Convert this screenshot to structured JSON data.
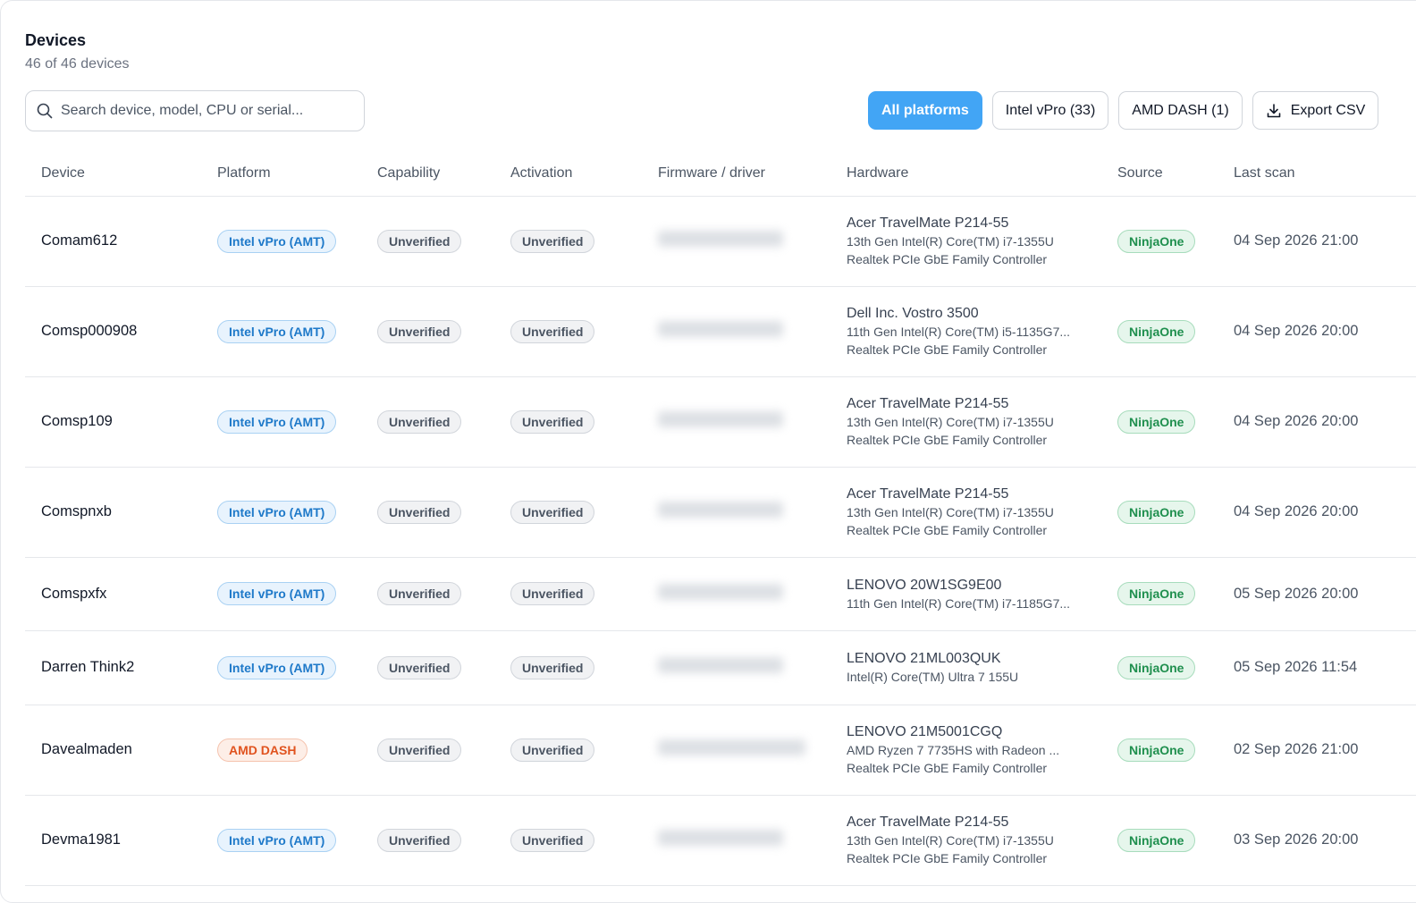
{
  "header": {
    "title": "Devices",
    "subtitle": "46 of 46 devices"
  },
  "search": {
    "placeholder": "Search device, model, CPU or serial..."
  },
  "filters": {
    "all": "All platforms",
    "intel": "Intel vPro (33)",
    "amd": "AMD DASH (1)",
    "export": "Export CSV"
  },
  "columns": {
    "device": "Device",
    "platform": "Platform",
    "capability": "Capability",
    "activation": "Activation",
    "firmware": "Firmware / driver",
    "hardware": "Hardware",
    "source": "Source",
    "last_scan": "Last scan"
  },
  "colors": {
    "accent": "#42a5f5",
    "intel_pill": "#1e79c9",
    "amd_pill": "#e0531f",
    "source_pill": "#1f8f4e"
  },
  "rows": [
    {
      "device": "Comam612",
      "platform": "Intel vPro (AMT)",
      "platform_type": "intel",
      "capability": "Unverified",
      "activation": "Unverified",
      "hardware": [
        "Acer TravelMate P214-55",
        "13th Gen Intel(R) Core(TM) i7-1355U",
        "Realtek PCIe GbE Family Controller"
      ],
      "source": "NinjaOne",
      "last_scan": "04 Sep 2026 21:00"
    },
    {
      "device": "Comsp000908",
      "platform": "Intel vPro (AMT)",
      "platform_type": "intel",
      "capability": "Unverified",
      "activation": "Unverified",
      "hardware": [
        "Dell Inc. Vostro 3500",
        "11th Gen Intel(R) Core(TM) i5-1135G7...",
        "Realtek PCIe GbE Family Controller"
      ],
      "source": "NinjaOne",
      "last_scan": "04 Sep 2026 20:00"
    },
    {
      "device": "Comsp109",
      "platform": "Intel vPro (AMT)",
      "platform_type": "intel",
      "capability": "Unverified",
      "activation": "Unverified",
      "hardware": [
        "Acer TravelMate P214-55",
        "13th Gen Intel(R) Core(TM) i7-1355U",
        "Realtek PCIe GbE Family Controller"
      ],
      "source": "NinjaOne",
      "last_scan": "04 Sep 2026 20:00"
    },
    {
      "device": "Comspnxb",
      "platform": "Intel vPro (AMT)",
      "platform_type": "intel",
      "capability": "Unverified",
      "activation": "Unverified",
      "hardware": [
        "Acer TravelMate P214-55",
        "13th Gen Intel(R) Core(TM) i7-1355U",
        "Realtek PCIe GbE Family Controller"
      ],
      "source": "NinjaOne",
      "last_scan": "04 Sep 2026 20:00"
    },
    {
      "device": "Comspxfx",
      "platform": "Intel vPro (AMT)",
      "platform_type": "intel",
      "capability": "Unverified",
      "activation": "Unverified",
      "hardware": [
        "LENOVO 20W1SG9E00",
        "11th Gen Intel(R) Core(TM) i7-1185G7..."
      ],
      "source": "NinjaOne",
      "last_scan": "05 Sep 2026 20:00"
    },
    {
      "device": "Darren Think2",
      "platform": "Intel vPro (AMT)",
      "platform_type": "intel",
      "capability": "Unverified",
      "activation": "Unverified",
      "hardware": [
        "LENOVO 21ML003QUK",
        "Intel(R) Core(TM) Ultra 7 155U"
      ],
      "source": "NinjaOne",
      "last_scan": "05 Sep 2026 11:54"
    },
    {
      "device": "Davealmaden",
      "platform": "AMD DASH",
      "platform_type": "amd",
      "capability": "Unverified",
      "activation": "Unverified",
      "hardware": [
        "LENOVO 21M5001CGQ",
        "AMD Ryzen 7 7735HS with Radeon ...",
        "Realtek PCIe GbE Family Controller"
      ],
      "source": "NinjaOne",
      "last_scan": "02 Sep 2026 21:00"
    },
    {
      "device": "Devma1981",
      "platform": "Intel vPro (AMT)",
      "platform_type": "intel",
      "capability": "Unverified",
      "activation": "Unverified",
      "hardware": [
        "Acer TravelMate P214-55",
        "13th Gen Intel(R) Core(TM) i7-1355U",
        "Realtek PCIe GbE Family Controller"
      ],
      "source": "NinjaOne",
      "last_scan": "03 Sep 2026 20:00"
    }
  ]
}
